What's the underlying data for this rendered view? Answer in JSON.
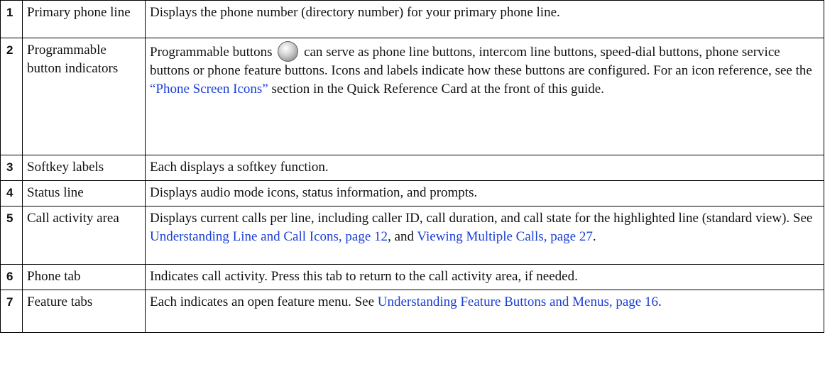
{
  "rows": [
    {
      "number": "1",
      "label": "Primary phone line",
      "description": "Displays the phone number (directory number) for your primary phone line."
    },
    {
      "number": "2",
      "label": "Programmable button indicators",
      "description_part1": "Programmable buttons",
      "icon": "programmable-button-icon",
      "description_part2": "can serve as phone line buttons, intercom line buttons, speed-dial buttons, phone service buttons or phone feature buttons. Icons and labels indicate how these buttons are configured. For an icon reference, see the",
      "link": "“Phone Screen Icons”",
      "description_part3": "section in the Quick Reference Card at the front of this guide."
    },
    {
      "number": "3",
      "label": "Softkey labels",
      "description": "Each displays a softkey function."
    },
    {
      "number": "4",
      "label": "Status line",
      "description": "Displays audio mode icons, status information, and prompts."
    },
    {
      "number": "5",
      "label": "Call activity area",
      "description_part1": "Displays current calls per line, including caller ID, call duration, and call state for the highlighted line (standard view). See",
      "link1": "Understanding Line and Call Icons, page 12",
      "description_part2": ", and",
      "link2": "Viewing Multiple Calls, page 27",
      "description_part3": "."
    },
    {
      "number": "6",
      "label": "Phone tab",
      "description": "Indicates call activity. Press this tab to return to the call activity area, if needed."
    },
    {
      "number": "7",
      "label": "Feature tabs",
      "description_part1": "Each indicates an open feature menu. See",
      "link": "Understanding Feature Buttons and Menus, page 16",
      "description_part2": "."
    }
  ],
  "colors": {
    "link": "#1a3fd6",
    "border": "#000000",
    "text": "#111111"
  }
}
